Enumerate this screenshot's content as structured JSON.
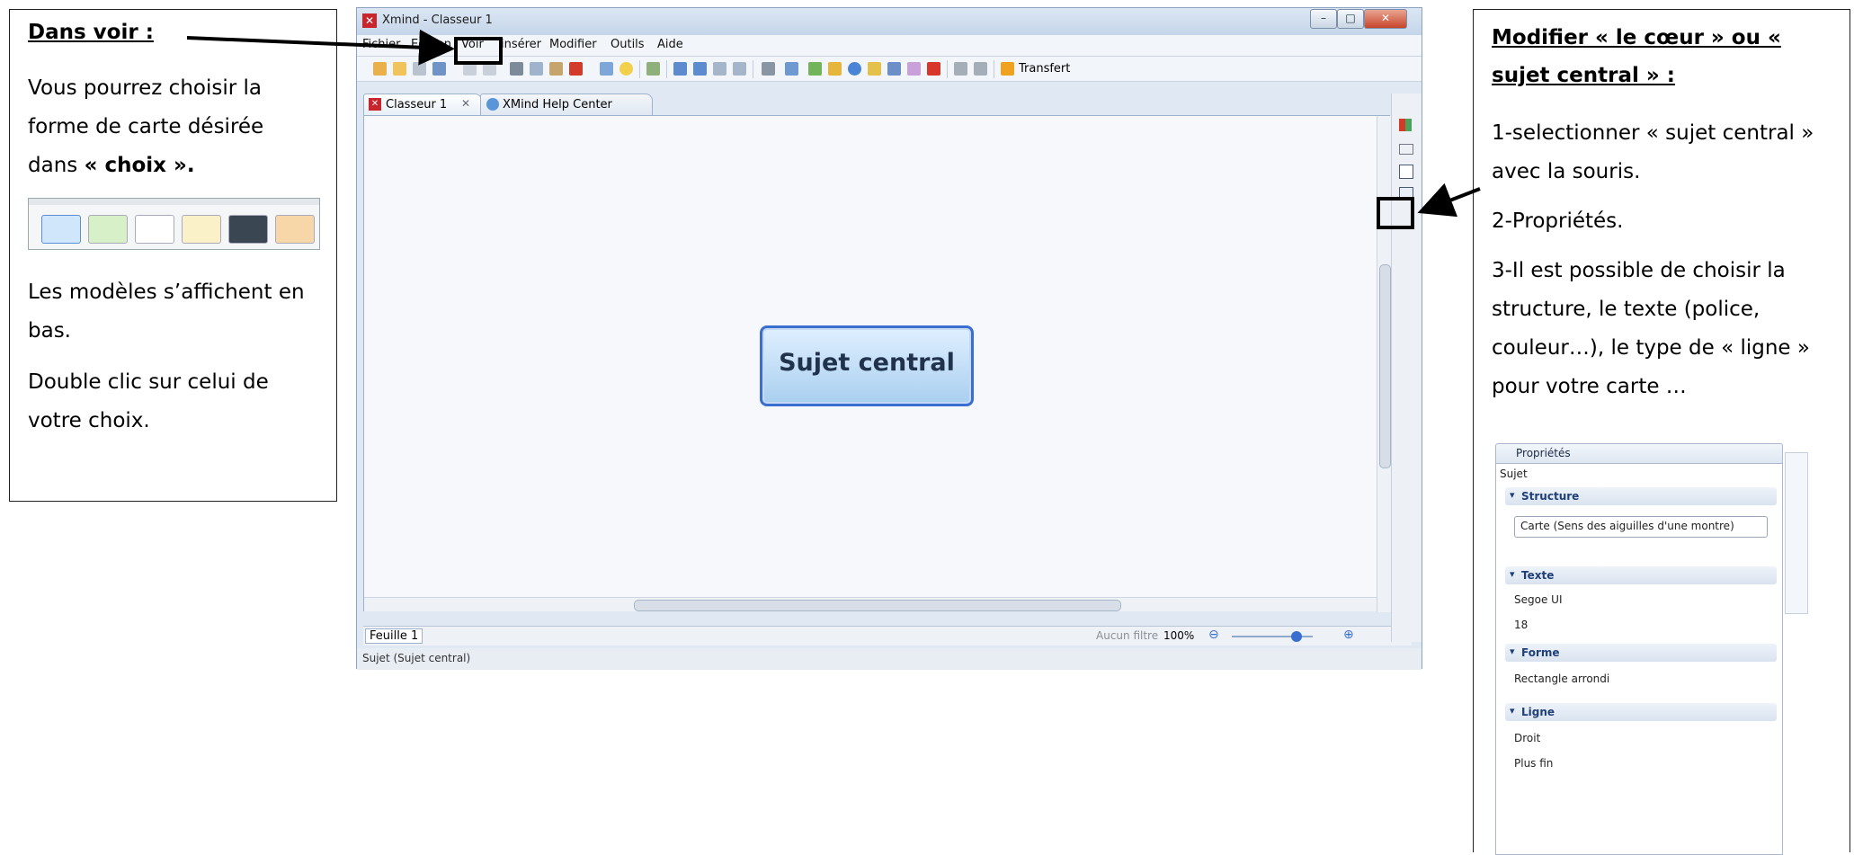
{
  "left_note": {
    "title": "Dans voir :",
    "p1_prefix": "Vous pourrez choisir la forme de carte désirée dans ",
    "p1_bold": "« choix ».",
    "p2": "Les modèles s’affichent en bas.",
    "p3": "Double clic sur celui de votre choix."
  },
  "right_note": {
    "title": "Modifier « le cœur » ou « sujet central » :",
    "step1": "1-selectionner « sujet central » avec la souris.",
    "step2": "2-Propriétés.",
    "step3": "3-Il est possible de choisir la structure, le texte (police, couleur…), le type de « ligne » pour votre carte …"
  },
  "properties_panel": {
    "title": "Propriétés",
    "subject": "Sujet",
    "structure_label": "Structure",
    "structure_value": "Carte (Sens des aiguilles d'une montre)",
    "texte_label": "Texte",
    "font_name": "Segoe UI",
    "font_size": "18",
    "forme_label": "Forme",
    "forme_value": "Rectangle arrondi",
    "ligne_label": "Ligne",
    "ligne_value": "Droit",
    "ligne_weight": "Plus fin"
  },
  "window": {
    "title": "Xmind - Classeur 1",
    "menu": [
      "Fichier",
      "Edition",
      "Voir",
      "insérer",
      "Modifier",
      "Outils",
      "Aide"
    ],
    "toolbar_transfer": "Transfert",
    "tabs": [
      "Classeur 1",
      "XMind Help Center"
    ],
    "central_topic": "Sujet central",
    "sheet_tab": "Feuille 1",
    "filter": "Aucun filtre",
    "zoom": "100%",
    "status": "Sujet (Sujet central)"
  },
  "colors": {
    "central_border": "#3b6fcf",
    "app_icon": "#c8262c",
    "window_chrome": "#dfe8f3"
  }
}
